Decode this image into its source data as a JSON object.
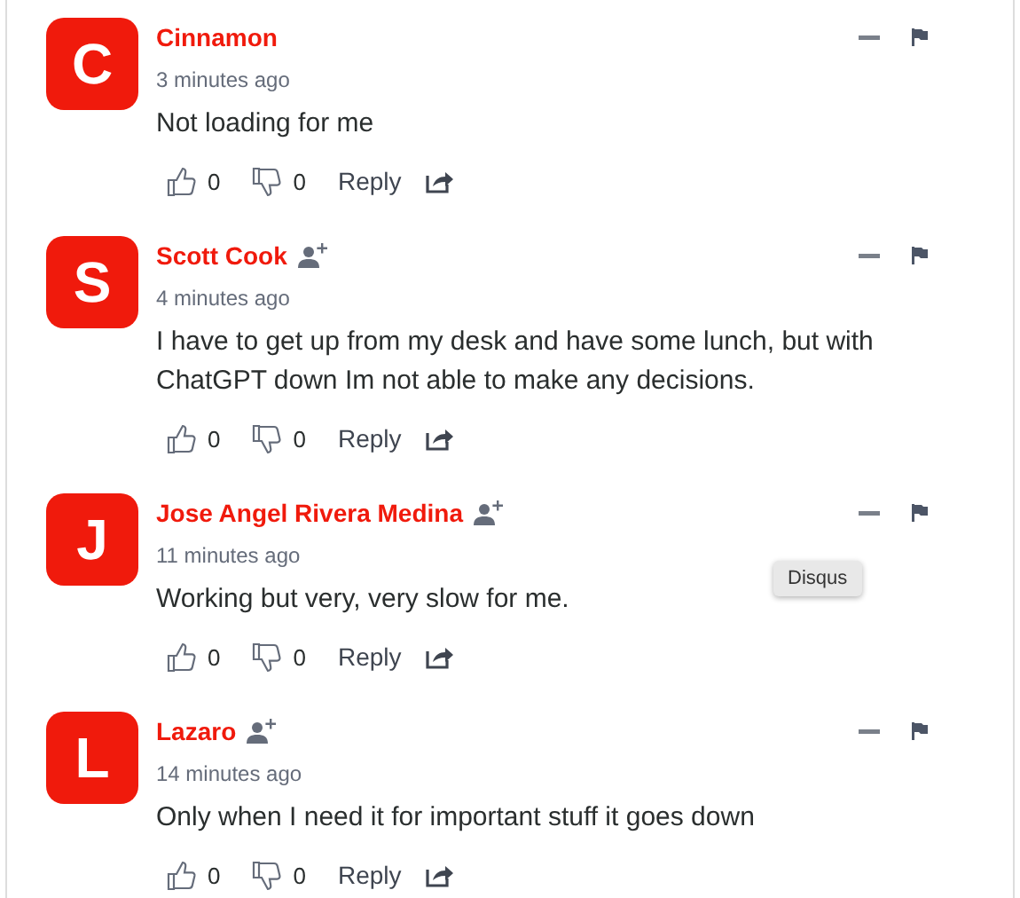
{
  "comments": [
    {
      "initial": "C",
      "author": "Cinnamon",
      "follow_icon": false,
      "time": "3 minutes ago",
      "text": "Not loading for me",
      "upvotes": "0",
      "downvotes": "0",
      "reply": "Reply"
    },
    {
      "initial": "S",
      "author": "Scott Cook",
      "follow_icon": true,
      "time": "4 minutes ago",
      "text": "I have to get up from my desk and have some lunch, but with ChatGPT down Im not able to make any decisions.",
      "upvotes": "0",
      "downvotes": "0",
      "reply": "Reply"
    },
    {
      "initial": "J",
      "author": "Jose Angel Rivera Medina",
      "follow_icon": true,
      "time": "11 minutes ago",
      "text": "Working but very, very slow for me.",
      "upvotes": "0",
      "downvotes": "0",
      "reply": "Reply"
    },
    {
      "initial": "L",
      "author": "Lazaro",
      "follow_icon": true,
      "time": "14 minutes ago",
      "text": "Only when I need it for important stuff it goes down",
      "upvotes": "0",
      "downvotes": "0",
      "reply": "Reply"
    }
  ],
  "tooltip": {
    "text": "Disqus"
  }
}
